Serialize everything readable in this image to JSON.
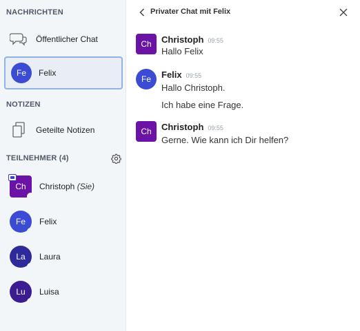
{
  "colors": {
    "purple": "#6a13a6",
    "blue": "#3b4bd4",
    "indigo": "#2f2a9a",
    "sidebar_bg": "#f3f6f9",
    "selection_border": "#8fb3e4"
  },
  "sidebar": {
    "messages_title": "NACHRICHTEN",
    "public_chat": {
      "label": "Öffentlicher Chat",
      "icon": "chat-bubbles-icon"
    },
    "private_chat": {
      "initials": "Fe",
      "label": "Felix",
      "avatar_color": "#3b4bd4"
    },
    "notes_title": "NOTIZEN",
    "shared_notes": {
      "label": "Geteilte Notizen",
      "icon": "notes-icon"
    },
    "participants_title": "TEILNEHMER (4)",
    "settings_icon": "gear-icon",
    "participants": [
      {
        "initials": "Ch",
        "name": "Christoph",
        "suffix": "(Sie)",
        "color": "#6a13a6",
        "shape": "rounded",
        "presenter": true
      },
      {
        "initials": "Fe",
        "name": "Felix",
        "suffix": "",
        "color": "#3b4bd4",
        "shape": "circle",
        "presenter": false
      },
      {
        "initials": "La",
        "name": "Laura",
        "suffix": "",
        "color": "#2f2a9a",
        "shape": "circle",
        "presenter": false
      },
      {
        "initials": "Lu",
        "name": "Luisa",
        "suffix": "",
        "color": "#3b1d8f",
        "shape": "circle",
        "presenter": false
      }
    ]
  },
  "chat": {
    "title": "Privater Chat mit Felix",
    "messages": [
      {
        "initials": "Ch",
        "author": "Christoph",
        "time": "09:55",
        "lines": [
          "Hallo Felix"
        ],
        "color": "#6a13a6",
        "shape": "rounded"
      },
      {
        "initials": "Fe",
        "author": "Felix",
        "time": "09:55",
        "lines": [
          "Hallo Christoph.",
          "Ich habe eine Frage."
        ],
        "color": "#3b4bd4",
        "shape": "circle"
      },
      {
        "initials": "Ch",
        "author": "Christoph",
        "time": "09:55",
        "lines": [
          "Gerne. Wie kann ich Dir helfen?"
        ],
        "color": "#6a13a6",
        "shape": "rounded"
      }
    ]
  }
}
